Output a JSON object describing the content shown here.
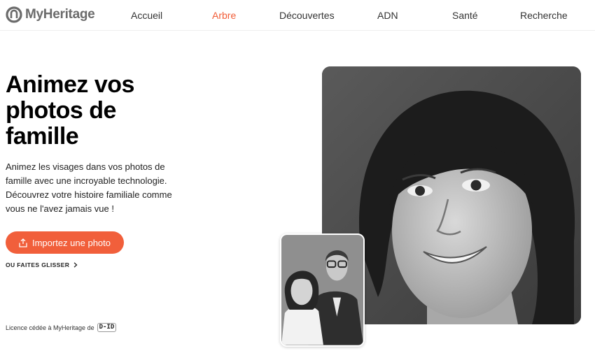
{
  "header": {
    "logo_text": "MyHeritage",
    "nav": [
      {
        "label": "Accueil"
      },
      {
        "label": "Arbre",
        "active": true
      },
      {
        "label": "Découvertes"
      },
      {
        "label": "ADN"
      },
      {
        "label": "Santé"
      },
      {
        "label": "Recherche"
      }
    ],
    "active_color": "#f15b35"
  },
  "hero": {
    "title": "Animez vos photos de famille",
    "description": "Animez les visages dans vos photos de famille avec une incroyable technologie. Découvrez votre histoire familiale comme vous ne l'avez jamais vue !",
    "import_button": "Importez une photo",
    "drag_link": "OU FAITES GLISSER",
    "license_text": "Licence cédée à MyHeritage de",
    "license_logo": "D-ID"
  },
  "colors": {
    "accent": "#f15f3b"
  },
  "icons": {
    "upload": "upload-icon",
    "chevron": "chevron-right-icon"
  }
}
